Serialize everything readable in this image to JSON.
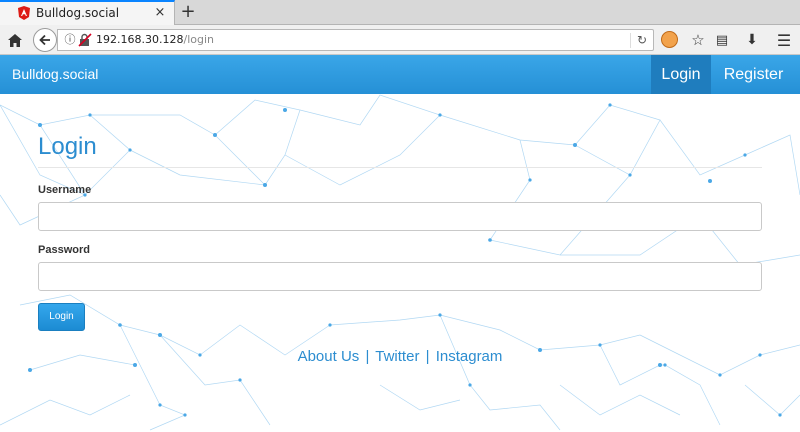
{
  "browser": {
    "tab_title": "Bulldog.social",
    "tab_close": "×",
    "new_tab": "+",
    "url_host": "192.168.30.128",
    "url_path": "/login",
    "reload_glyph": "C"
  },
  "app": {
    "brand": "Bulldog.social",
    "nav": {
      "login": "Login",
      "register": "Register"
    },
    "accent_color": "#2590d6"
  },
  "form": {
    "heading": "Login",
    "username_label": "Username",
    "username_value": "",
    "password_label": "Password",
    "password_value": "",
    "submit_label": "Login"
  },
  "footer": {
    "links": [
      "About Us",
      "Twitter",
      "Instagram"
    ],
    "separator": "|"
  },
  "icons": {
    "home": "home-icon",
    "back": "back-arrow-icon",
    "info": "info-icon",
    "insecure": "insecure-lock-icon",
    "reload": "reload-icon",
    "extension": "extension-icon",
    "bookmark": "star-icon",
    "reader": "reader-view-icon",
    "download": "download-icon",
    "menu": "hamburger-menu-icon"
  }
}
